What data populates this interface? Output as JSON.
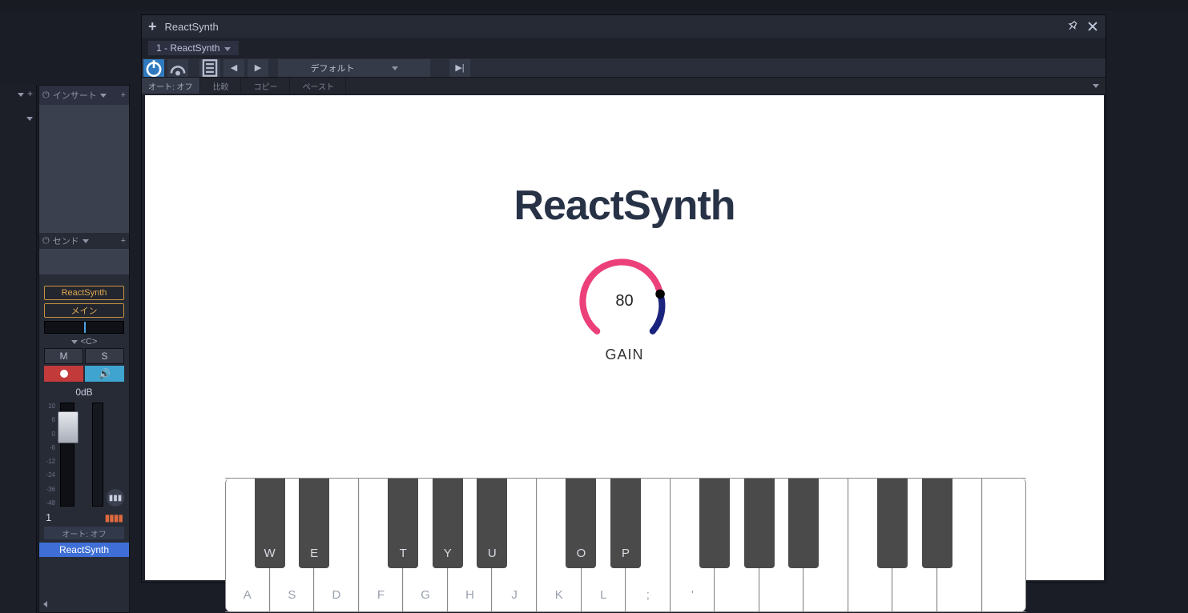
{
  "window": {
    "title": "ReactSynth",
    "tab_label": "1 - ReactSynth",
    "preset": "デフォルト",
    "subbar": {
      "auto": "オート: オフ",
      "compare": "比較",
      "copy": "コピー",
      "paste": "ペースト"
    }
  },
  "channel": {
    "insert_label": "インサート",
    "send_label": "センド",
    "plugin_slot": "ReactSynth",
    "output_slot": "メイン",
    "pan_label": "<C>",
    "mute": "M",
    "solo": "S",
    "db": "0dB",
    "scale": [
      "10",
      "6",
      "0",
      "-6",
      "-12",
      "-24",
      "-36",
      "-48"
    ],
    "track_number": "1",
    "auto": "オート: オフ",
    "track_name": "ReactSynth"
  },
  "synth": {
    "title": "ReactSynth",
    "gain_value": "80",
    "gain_label": "GAIN",
    "white_keys": [
      "A",
      "S",
      "D",
      "F",
      "G",
      "H",
      "J",
      "K",
      "L",
      ";",
      "'",
      "",
      "",
      "",
      "",
      "",
      "",
      ""
    ],
    "black_keys": [
      {
        "pos": 0,
        "label": "W"
      },
      {
        "pos": 1,
        "label": "E"
      },
      {
        "pos": 3,
        "label": "T"
      },
      {
        "pos": 4,
        "label": "Y"
      },
      {
        "pos": 5,
        "label": "U"
      },
      {
        "pos": 7,
        "label": "O"
      },
      {
        "pos": 8,
        "label": "P"
      },
      {
        "pos": 10,
        "label": ""
      },
      {
        "pos": 11,
        "label": ""
      },
      {
        "pos": 12,
        "label": ""
      },
      {
        "pos": 14,
        "label": ""
      },
      {
        "pos": 15,
        "label": ""
      }
    ]
  }
}
